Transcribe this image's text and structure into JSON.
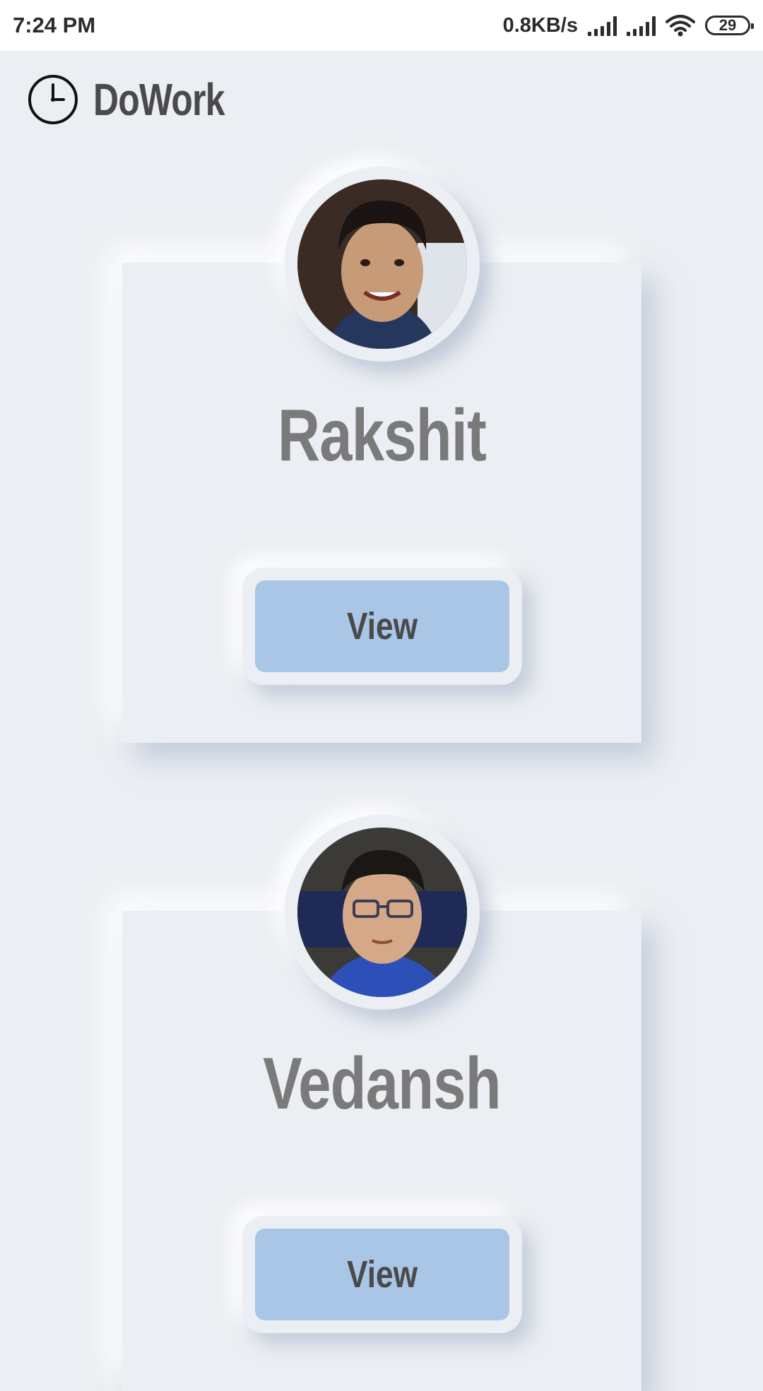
{
  "status_bar": {
    "time": "7:24 PM",
    "network_speed": "0.8KB/s",
    "battery": "29",
    "icons": [
      "signal-icon",
      "signal-icon",
      "wifi-icon",
      "battery-icon"
    ]
  },
  "header": {
    "app_name": "DoWork",
    "icon": "clock-icon"
  },
  "profiles": [
    {
      "name": "Rakshit",
      "button_label": "View",
      "avatar": "person-photo"
    },
    {
      "name": "Vedansh",
      "button_label": "View",
      "avatar": "person-photo"
    }
  ],
  "colors": {
    "background": "#EBEEF2",
    "button": "#A9C6E6",
    "name_text": "#7A7A7A",
    "title_text": "#4A4A4A"
  }
}
